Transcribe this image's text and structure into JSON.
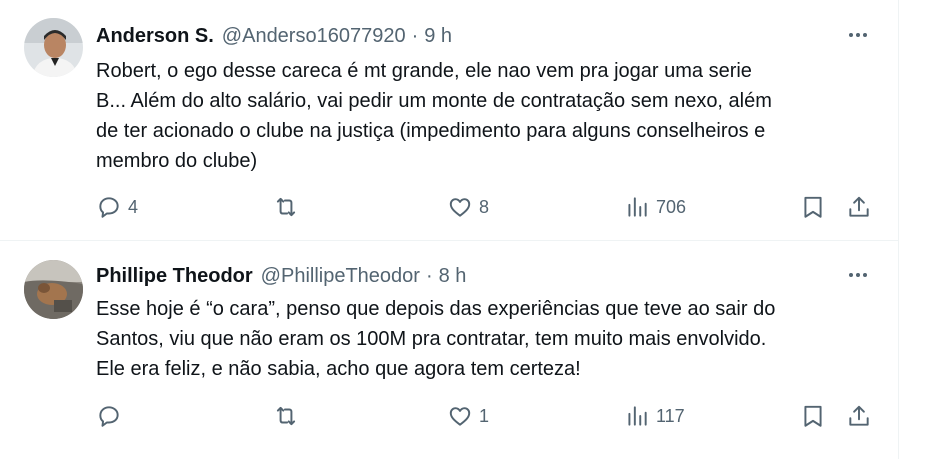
{
  "tweets": [
    {
      "author_name": "Anderson S.",
      "handle": "@Anderso16077920",
      "separator": "·",
      "time": "9 h",
      "text": "Robert, o ego desse careca é mt grande, ele nao vem pra jogar uma serie\nB... Além do alto salário, vai pedir um monte de contratação sem nexo, além\nde ter acionado o clube na justiça (impedimento para alguns conselheiros e\nmembro do clube)",
      "replies": "4",
      "retweets": "",
      "likes": "8",
      "views": "706",
      "avatar_icon": "person-photo"
    },
    {
      "author_name": "Phillipe Theodor",
      "handle": "@PhillipeTheodor",
      "separator": "·",
      "time": "8 h",
      "text": "Esse hoje é “o cara”, penso que depois das experiências que teve ao sair do\nSantos, viu que não eram os 100M pra contratar, tem muito mais envolvido.\nEle era feliz, e não sabia, acho que agora tem certeza!",
      "replies": "",
      "retweets": "",
      "likes": "1",
      "views": "117",
      "avatar_icon": "dog-photo"
    }
  ],
  "colors": {
    "text": "#0f1419",
    "secondary": "#536471",
    "border": "#eff3f4"
  }
}
